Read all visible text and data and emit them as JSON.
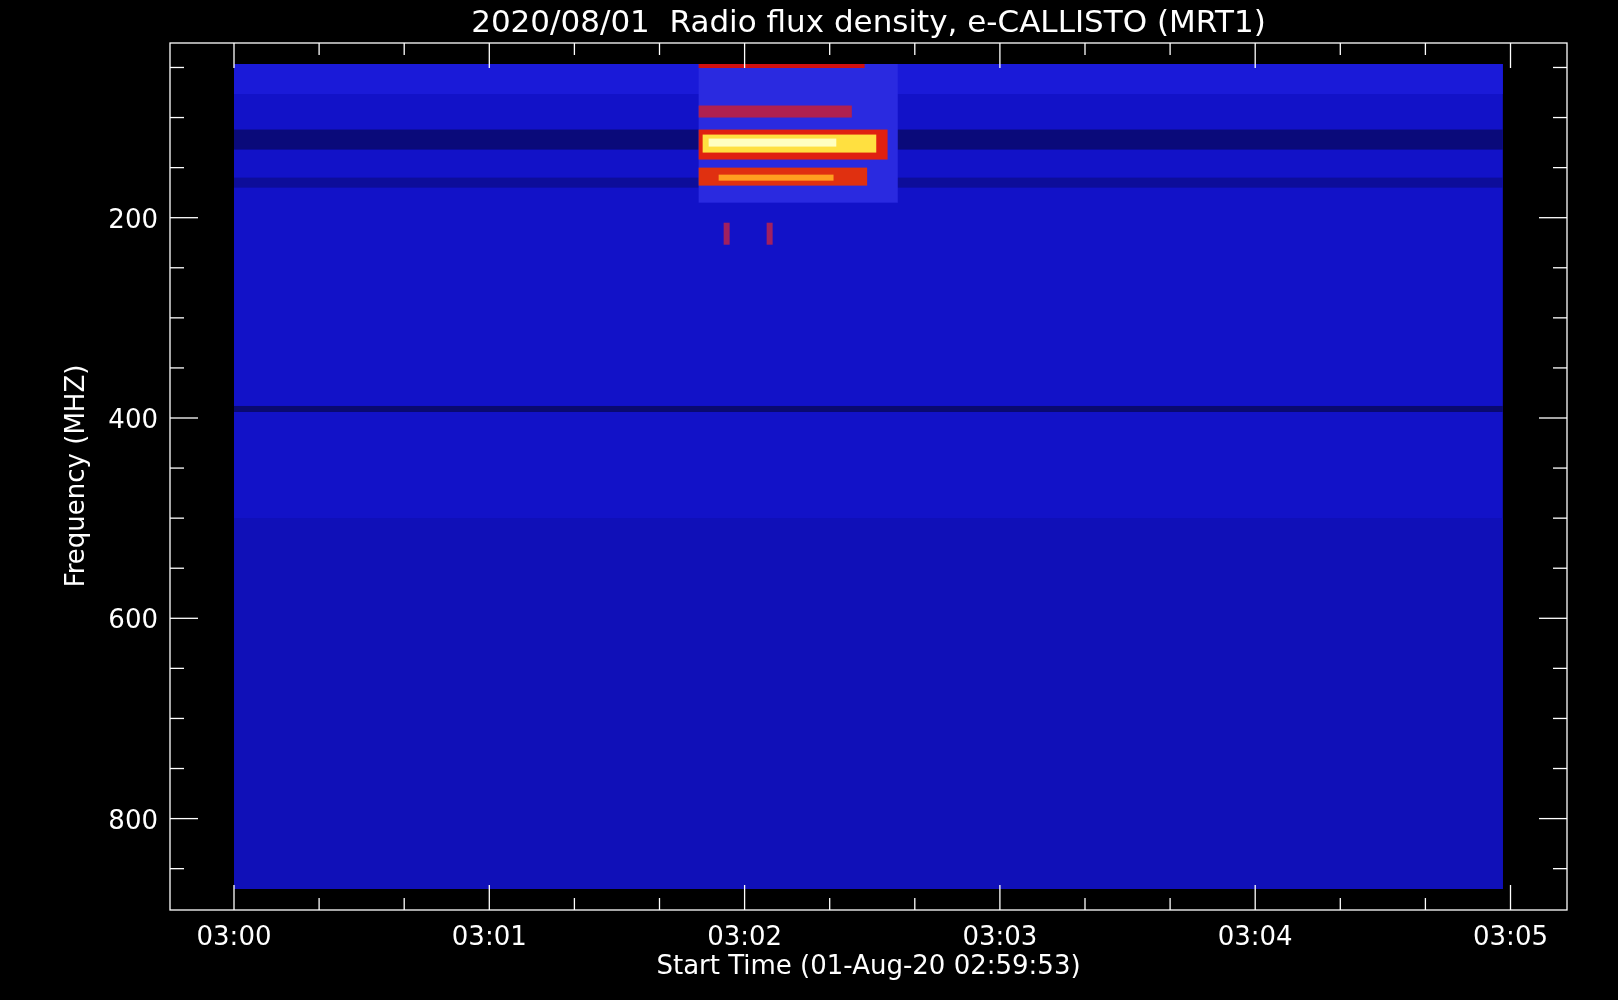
{
  "title": "2020/08/01  Radio flux density, e-CALLISTO (MRT1)",
  "x_axis": {
    "label": "Start Time (01-Aug-20 02:59:53)",
    "ticks": [
      "03:00",
      "03:01",
      "03:02",
      "03:03",
      "03:04",
      "03:05"
    ]
  },
  "y_axis": {
    "label": "Frequency (MHZ)",
    "ticks": [
      "200",
      "400",
      "600",
      "800"
    ]
  }
}
